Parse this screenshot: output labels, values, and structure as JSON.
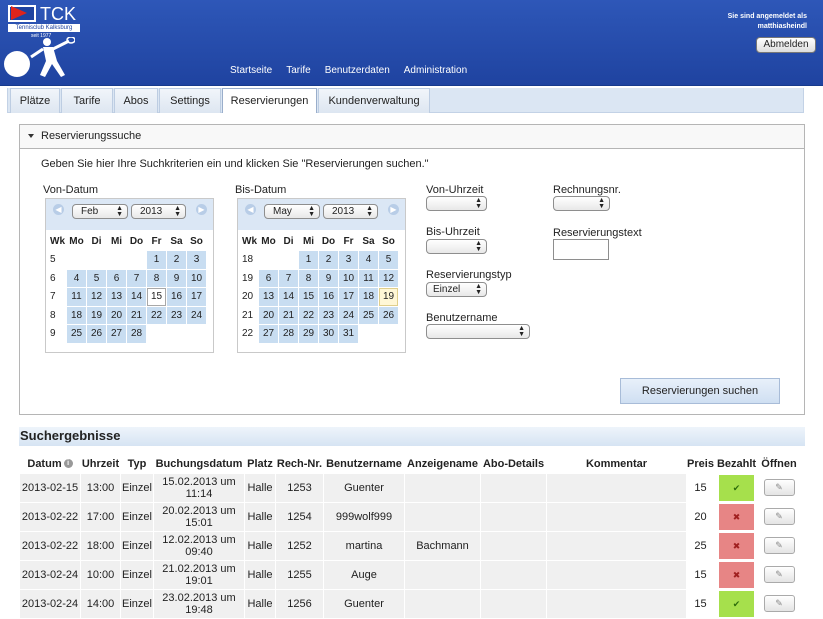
{
  "logo": {
    "text": "TCK",
    "club": "Tennisclub Kalksburg",
    "since": "seit 1977"
  },
  "user": {
    "line1": "Sie sind angemeldet als",
    "line2": "matthiasheindl",
    "logout": "Abmelden"
  },
  "mainnav": [
    "Startseite",
    "Tarife",
    "Benutzerdaten",
    "Administration"
  ],
  "tabs": [
    "Plätze",
    "Tarife",
    "Abos",
    "Settings",
    "Reservierungen",
    "Kundenverwaltung"
  ],
  "search": {
    "title": "Reservierungssuche",
    "intro": "Geben Sie hier Ihre Suchkriterien ein und klicken Sie \"Reservierungen suchen.\"",
    "from_label": "Von-Datum",
    "to_label": "Bis-Datum",
    "from_time_label": "Von-Uhrzeit",
    "to_time_label": "Bis-Uhrzeit",
    "type_label": "Reservierungstyp",
    "type_value": "Einzel",
    "user_label": "Benutzername",
    "invoice_label": "Rechnungsnr.",
    "text_label": "Reservierungstext",
    "button": "Reservierungen suchen",
    "weekday_headers": [
      "Wk",
      "Mo",
      "Di",
      "Mi",
      "Do",
      "Fr",
      "Sa",
      "So"
    ],
    "cal_from": {
      "month": "Feb",
      "year": "2013",
      "weeks": [
        {
          "wk": "5",
          "days": [
            "",
            "",
            "",
            "",
            "1",
            "2",
            "3"
          ]
        },
        {
          "wk": "6",
          "days": [
            "4",
            "5",
            "6",
            "7",
            "8",
            "9",
            "10"
          ]
        },
        {
          "wk": "7",
          "days": [
            "11",
            "12",
            "13",
            "14",
            "15",
            "16",
            "17"
          ]
        },
        {
          "wk": "8",
          "days": [
            "18",
            "19",
            "20",
            "21",
            "22",
            "23",
            "24"
          ]
        },
        {
          "wk": "9",
          "days": [
            "25",
            "26",
            "27",
            "28",
            "",
            "",
            ""
          ]
        }
      ]
    },
    "cal_to": {
      "month": "May",
      "year": "2013",
      "weeks": [
        {
          "wk": "18",
          "days": [
            "",
            "",
            "1",
            "2",
            "3",
            "4",
            "5"
          ]
        },
        {
          "wk": "19",
          "days": [
            "6",
            "7",
            "8",
            "9",
            "10",
            "11",
            "12"
          ]
        },
        {
          "wk": "20",
          "days": [
            "13",
            "14",
            "15",
            "16",
            "17",
            "18",
            "19"
          ]
        },
        {
          "wk": "21",
          "days": [
            "20",
            "21",
            "22",
            "23",
            "24",
            "25",
            "26"
          ]
        },
        {
          "wk": "22",
          "days": [
            "27",
            "28",
            "29",
            "30",
            "31",
            "",
            ""
          ]
        }
      ]
    }
  },
  "results": {
    "title": "Suchergebnisse",
    "columns": [
      "Datum",
      "Uhrzeit",
      "Typ",
      "Buchungsdatum",
      "Platz",
      "Rech-Nr.",
      "Benutzername",
      "Anzeigename",
      "Abo-Details",
      "Kommentar",
      "Preis",
      "Bezahlt",
      "Öffnen"
    ],
    "rows": [
      {
        "date": "2013-02-15",
        "time": "13:00",
        "type": "Einzel",
        "booked": [
          "15.02.2013 um",
          "11:14"
        ],
        "court": "Halle",
        "invoice": "1253",
        "user": "Guenter",
        "display": "",
        "abo": "",
        "comment": "",
        "price": "15",
        "paid": true
      },
      {
        "date": "2013-02-22",
        "time": "17:00",
        "type": "Einzel",
        "booked": [
          "20.02.2013 um",
          "15:01"
        ],
        "court": "Halle",
        "invoice": "1254",
        "user": "999wolf999",
        "display": "",
        "abo": "",
        "comment": "",
        "price": "20",
        "paid": false
      },
      {
        "date": "2013-02-22",
        "time": "18:00",
        "type": "Einzel",
        "booked": [
          "12.02.2013 um",
          "09:40"
        ],
        "court": "Halle",
        "invoice": "1252",
        "user": "martina",
        "display": "Bachmann",
        "abo": "",
        "comment": "",
        "price": "25",
        "paid": false
      },
      {
        "date": "2013-02-24",
        "time": "10:00",
        "type": "Einzel",
        "booked": [
          "21.02.2013 um",
          "19:01"
        ],
        "court": "Halle",
        "invoice": "1255",
        "user": "Auge",
        "display": "",
        "abo": "",
        "comment": "",
        "price": "15",
        "paid": false
      },
      {
        "date": "2013-02-24",
        "time": "14:00",
        "type": "Einzel",
        "booked": [
          "23.02.2013 um",
          "19:48"
        ],
        "court": "Halle",
        "invoice": "1256",
        "user": "Guenter",
        "display": "",
        "abo": "",
        "comment": "",
        "price": "15",
        "paid": true
      }
    ]
  },
  "colors": {
    "header": "#2e57b8",
    "cal_day": "#c8ddf1",
    "paid": "#a6e04c",
    "unpaid": "#e78585"
  }
}
